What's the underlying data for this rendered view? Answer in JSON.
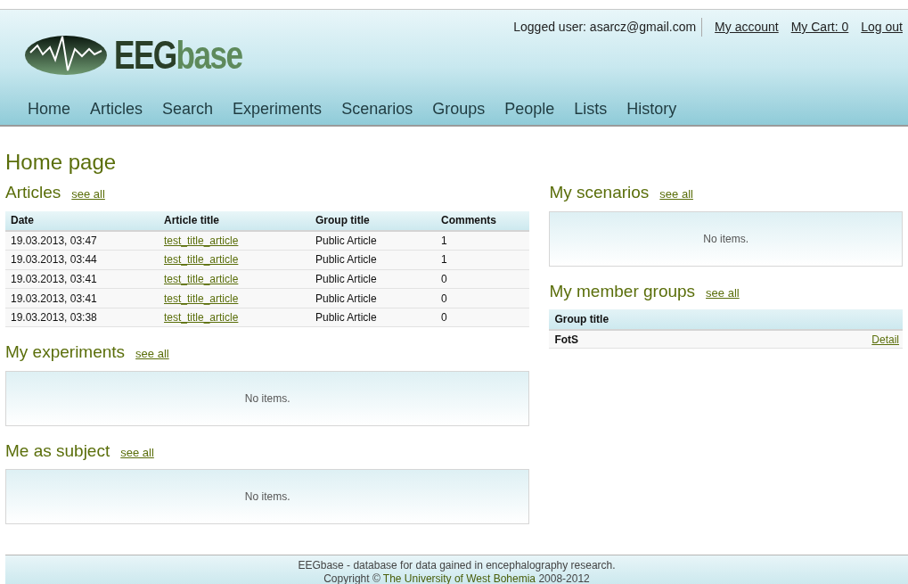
{
  "header": {
    "logo": {
      "dark": "EEG",
      "light": "base"
    },
    "logged_user": "Logged user: asarcz@gmail.com",
    "user_links": [
      "My account",
      "My Cart: 0",
      "Log out"
    ],
    "nav": [
      "Home",
      "Articles",
      "Search",
      "Experiments",
      "Scenarios",
      "Groups",
      "People",
      "Lists",
      "History"
    ]
  },
  "page_title": "Home page",
  "left": [
    {
      "kind": "table",
      "title": "Articles",
      "see_all": "see all",
      "columns": [
        "Date",
        "Article title",
        "Group title",
        "Comments"
      ],
      "rows": [
        [
          "19.03.2013, 03:47",
          "test_title_article",
          "Public Article",
          "1"
        ],
        [
          "19.03.2013, 03:44",
          "test_title_article",
          "Public Article",
          "1"
        ],
        [
          "19.03.2013, 03:41",
          "test_title_article",
          "Public Article",
          "0"
        ],
        [
          "19.03.2013, 03:41",
          "test_title_article",
          "Public Article",
          "0"
        ],
        [
          "19.03.2013, 03:38",
          "test_title_article",
          "Public Article",
          "0"
        ]
      ]
    },
    {
      "kind": "empty",
      "title": "My experiments",
      "see_all": "see all",
      "message": "No items."
    },
    {
      "kind": "empty",
      "title": "Me as subject",
      "see_all": "see all",
      "message": "No items."
    }
  ],
  "right": [
    {
      "kind": "empty",
      "title": "My scenarios",
      "see_all": "see all",
      "message": "No items."
    },
    {
      "kind": "groups",
      "title": "My member groups",
      "see_all": "see all",
      "columns": [
        "Group title"
      ],
      "rows": [
        {
          "title": "FotS",
          "action": "Detail"
        }
      ]
    }
  ],
  "footer": {
    "line1": "EEGbase - database for data gained in encephalography research.",
    "prefix": "Copyright © ",
    "link": "The University of West Bohemia",
    "suffix": " 2008-2012"
  }
}
